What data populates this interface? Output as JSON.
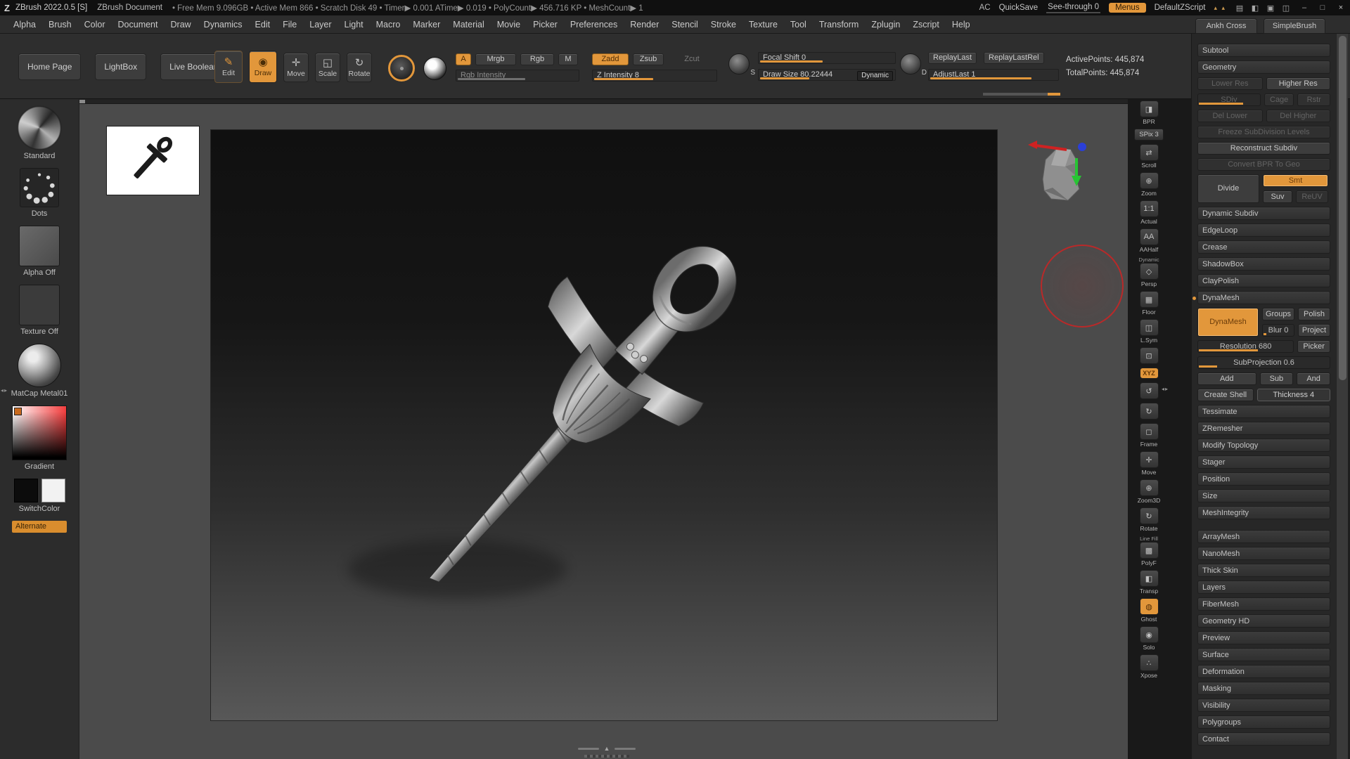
{
  "accent_color": "#e2973b",
  "ui": {
    "divider_arrows": "◂▸",
    "bottom_arrow": "▲"
  },
  "titlebar": {
    "logo": "Z",
    "app": "ZBrush 2022.0.5 [S]",
    "doc": "ZBrush Document",
    "stats": "• Free Mem 9.096GB • Active Mem 866 • Scratch Disk 49 • Timer▶ 0.001 ATime▶ 0.019 • PolyCount▶ 456.716 KP • MeshCount▶ 1",
    "ac": "AC",
    "quicksave": "QuickSave",
    "see_through": "See-through 0",
    "menus": "Menus",
    "default_zscript": "DefaultZScript",
    "tray_arrows": "▴ ▴",
    "window_icons": [
      "▤",
      "◧",
      "▣",
      "◫"
    ],
    "minimize": "–",
    "maximize": "□",
    "close": "×"
  },
  "menubar": {
    "items": [
      "Alpha",
      "Brush",
      "Color",
      "Document",
      "Draw",
      "Dynamics",
      "Edit",
      "File",
      "Layer",
      "Light",
      "Macro",
      "Marker",
      "Material",
      "Movie",
      "Picker",
      "Preferences",
      "Render",
      "Stencil",
      "Stroke",
      "Texture",
      "Tool",
      "Transform",
      "Zplugin",
      "Zscript",
      "Help"
    ]
  },
  "tool_tabs": [
    "Ankh Cross",
    "SimpleBrush"
  ],
  "shelf": {
    "home_page": "Home Page",
    "lightbox": "LightBox",
    "live_boolean": "Live Boolean",
    "edit": "Edit",
    "edit_icon": "✎",
    "draw": "Draw",
    "draw_icon": "◉",
    "move": "Move",
    "move_icon": "✛",
    "scale": "Scale",
    "scale_icon": "◱",
    "rotate": "Rotate",
    "rotate_icon": "↻",
    "a": "A",
    "mrgb": "Mrgb",
    "rgb": "Rgb",
    "m": "M",
    "zadd": "Zadd",
    "zsub": "Zsub",
    "zcut": "Zcut",
    "rgb_intensity": "Rgb Intensity",
    "z_intensity": "Z Intensity 8",
    "focal_shift": "Focal Shift 0",
    "draw_size": "Draw Size 80.22444",
    "dynamic": "Dynamic",
    "s": "S",
    "d": "D",
    "replay_last": "ReplayLast",
    "replay_last_rel": "ReplayLastRel",
    "adjust_last": "AdjustLast 1",
    "active_points": "ActivePoints: 445,874",
    "total_points": "TotalPoints: 445,874"
  },
  "left_tray": {
    "brush_label": "Standard",
    "stroke_label": "Dots",
    "alpha_label": "Alpha Off",
    "texture_label": "Texture Off",
    "material_label": "MatCap Metal01",
    "gradient_label": "Gradient",
    "switch_label": "SwitchColor",
    "alternate": "Alternate"
  },
  "right_shelf": {
    "items": [
      {
        "name": "bpr-button",
        "glyph": "◨",
        "label": "BPR"
      },
      {
        "name": "spix-slider",
        "glyph": "",
        "label": "SPix 3",
        "wide": true
      },
      {
        "name": "scroll-button",
        "glyph": "⇄",
        "label": "Scroll"
      },
      {
        "name": "zoom-button",
        "glyph": "⊕",
        "label": "Zoom"
      },
      {
        "name": "actual-button",
        "glyph": "1:1",
        "label": "Actual"
      },
      {
        "name": "aahalf-button",
        "glyph": "AA",
        "label": "AAHalf"
      },
      {
        "name": "persp-button",
        "sub": "Dynamic",
        "glyph": "◇",
        "label": "Persp"
      },
      {
        "name": "floor-button",
        "glyph": "▦",
        "label": "Floor"
      },
      {
        "name": "local-symmetry-button",
        "glyph": "◫",
        "label": "L.Sym"
      },
      {
        "name": "local-transform-icon",
        "glyph": "⊡",
        "label": ""
      },
      {
        "name": "xyz-button",
        "glyph": "XYZ",
        "label": "",
        "accent": true
      },
      {
        "name": "orbit-icon",
        "glyph": "↺",
        "label": ""
      },
      {
        "name": "spin-icon",
        "glyph": "↻",
        "label": ""
      },
      {
        "name": "frame-button",
        "glyph": "◻",
        "label": "Frame"
      },
      {
        "name": "move-canvas-button",
        "glyph": "✛",
        "label": "Move"
      },
      {
        "name": "zoom3d-button",
        "glyph": "⊕",
        "label": "Zoom3D"
      },
      {
        "name": "rotate-canvas-button",
        "glyph": "↻",
        "label": "Rotate"
      },
      {
        "name": "polyframe-button",
        "sub": "Line Fill",
        "glyph": "▩",
        "label": "PolyF"
      },
      {
        "name": "transp-button",
        "glyph": "◧",
        "label": "Transp"
      },
      {
        "name": "ghost-button",
        "glyph": "◍",
        "label": "Ghost",
        "active": true
      },
      {
        "name": "solo-button",
        "glyph": "◉",
        "label": "Solo"
      },
      {
        "name": "xpose-button",
        "glyph": "∴",
        "label": "Xpose"
      }
    ]
  },
  "tool": {
    "subtool": "Subtool",
    "geometry": "Geometry",
    "lower_res": "Lower Res",
    "higher_res": "Higher Res",
    "sdiv": "SDiv",
    "cage": "Cage",
    "rstr": "Rstr",
    "del_lower": "Del Lower",
    "del_higher": "Del Higher",
    "freeze": "Freeze SubDivision Levels",
    "reconstruct": "Reconstruct Subdiv",
    "convert_bpr": "Convert BPR To Geo",
    "divide": "Divide",
    "smt": "Smt",
    "suv": "Suv",
    "reuv": "ReUV",
    "sections_mid": [
      "Dynamic Subdiv",
      "EdgeLoop",
      "Crease",
      "ShadowBox",
      "ClayPolish"
    ],
    "dynamesh_header": "DynaMesh",
    "dynamesh_button": "DynaMesh",
    "groups": "Groups",
    "polish": "Polish",
    "blur": "Blur 0",
    "project": "Project",
    "resolution": "Resolution 680",
    "picker": "Picker",
    "subprojection": "SubProjection 0.6",
    "add": "Add",
    "sub": "Sub",
    "and": "And",
    "create_shell": "Create Shell",
    "thickness": "Thickness 4",
    "sections_lower": [
      "Tessimate",
      "ZRemesher",
      "Modify Topology",
      "Stager",
      "Position",
      "Size",
      "MeshIntegrity"
    ],
    "sections_bottom": [
      "ArrayMesh",
      "NanoMesh",
      "Thick Skin",
      "Layers",
      "FiberMesh",
      "Geometry HD",
      "Preview",
      "Surface",
      "Deformation",
      "Masking",
      "Visibility",
      "Polygroups",
      "Contact"
    ]
  }
}
